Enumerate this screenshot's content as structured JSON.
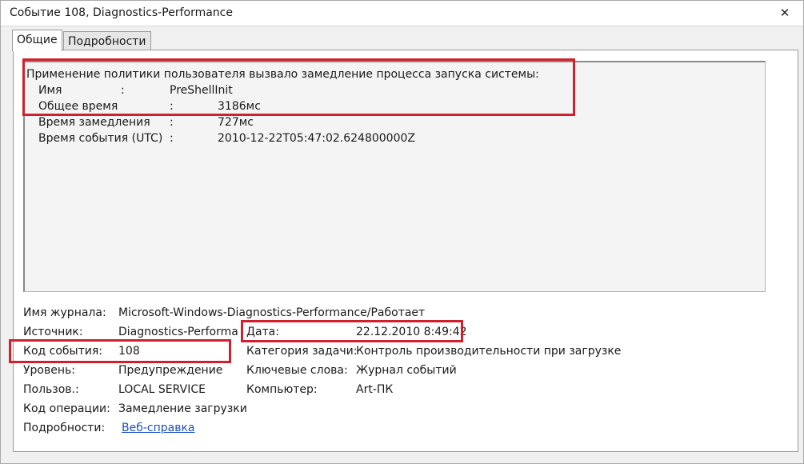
{
  "window": {
    "title": "Событие 108, Diagnostics-Performance",
    "close_glyph": "✕"
  },
  "tabs": [
    {
      "label": "Общие",
      "active": true
    },
    {
      "label": "Подробности",
      "active": false
    }
  ],
  "description": {
    "headline": "Применение политики пользователя вызвало замедление процесса запуска системы:",
    "fields": [
      {
        "label": "Имя",
        "colon": ":",
        "value": "PreShellInit"
      },
      {
        "label": "Общее время",
        "colon": ":",
        "value": "3186мс"
      },
      {
        "label": "Время замедления",
        "colon": ":",
        "value": "727мс"
      },
      {
        "label": "Время события (UTC)",
        "colon": ":",
        "value": "2010-12-22T05:47:02.624800000Z"
      }
    ]
  },
  "properties": {
    "log_name": {
      "label": "Имя журнала:",
      "value": "Microsoft-Windows-Diagnostics-Performance/Работает"
    },
    "source": {
      "label": "Источник:",
      "value": "Diagnostics-Performance"
    },
    "date": {
      "label": "Дата:",
      "value": "22.12.2010 8:49:42"
    },
    "event_id": {
      "label": "Код события:",
      "value": "108"
    },
    "task_category": {
      "label": "Категория задачи:",
      "value": "Контроль производительности при загрузке"
    },
    "level": {
      "label": "Уровень:",
      "value": "Предупреждение"
    },
    "keywords": {
      "label": "Ключевые слова:",
      "value": "Журнал событий"
    },
    "user": {
      "label": "Пользов.:",
      "value": "LOCAL SERVICE"
    },
    "computer": {
      "label": "Компьютер:",
      "value": "Art-ПК"
    },
    "opcode": {
      "label": "Код операции:",
      "value": "Замедление загрузки"
    },
    "more_info": {
      "label": "Подробности:",
      "value": "Веб-справка"
    }
  },
  "colors": {
    "highlight": "#d0202d",
    "link": "#1a4fc4"
  }
}
